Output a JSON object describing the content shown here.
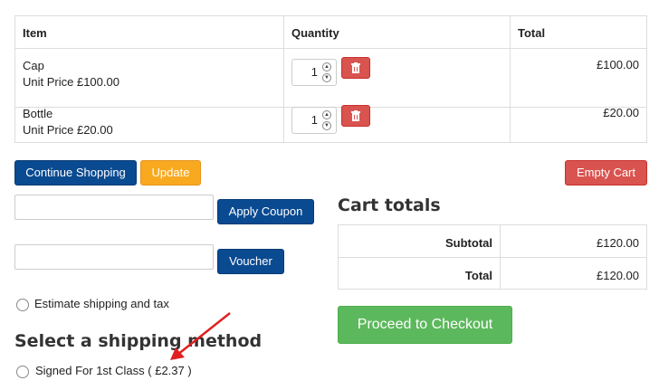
{
  "table": {
    "headers": {
      "item": "Item",
      "quantity": "Quantity",
      "total": "Total"
    },
    "rows": [
      {
        "name": "Cap",
        "unit_price": "Unit Price £100.00",
        "qty": "1",
        "total": "£100.00"
      },
      {
        "name": "Bottle",
        "unit_price": "Unit Price £20.00",
        "qty": "1",
        "total": "£20.00"
      }
    ]
  },
  "actions": {
    "continue": "Continue Shopping",
    "update": "Update",
    "empty": "Empty Cart"
  },
  "coupon": {
    "value": "",
    "button": "Apply Coupon"
  },
  "voucher": {
    "value": "",
    "button": "Voucher"
  },
  "estimate_label": "Estimate shipping and tax",
  "shipping": {
    "heading": "Select a shipping method",
    "option": "Signed For 1st Class ( £2.37 )"
  },
  "cart_totals": {
    "heading": "Cart totals",
    "subtotal_label": "Subtotal",
    "subtotal": "£120.00",
    "total_label": "Total",
    "total": "£120.00"
  },
  "checkout": "Proceed to Checkout",
  "colors": {
    "primary": "#0a4a91",
    "warning": "#f9a91f",
    "danger": "#d9534f",
    "success": "#5cb85c",
    "annotation": "#e02020"
  },
  "icons": {
    "delete": "trash-icon",
    "annotation": "red-arrow"
  }
}
